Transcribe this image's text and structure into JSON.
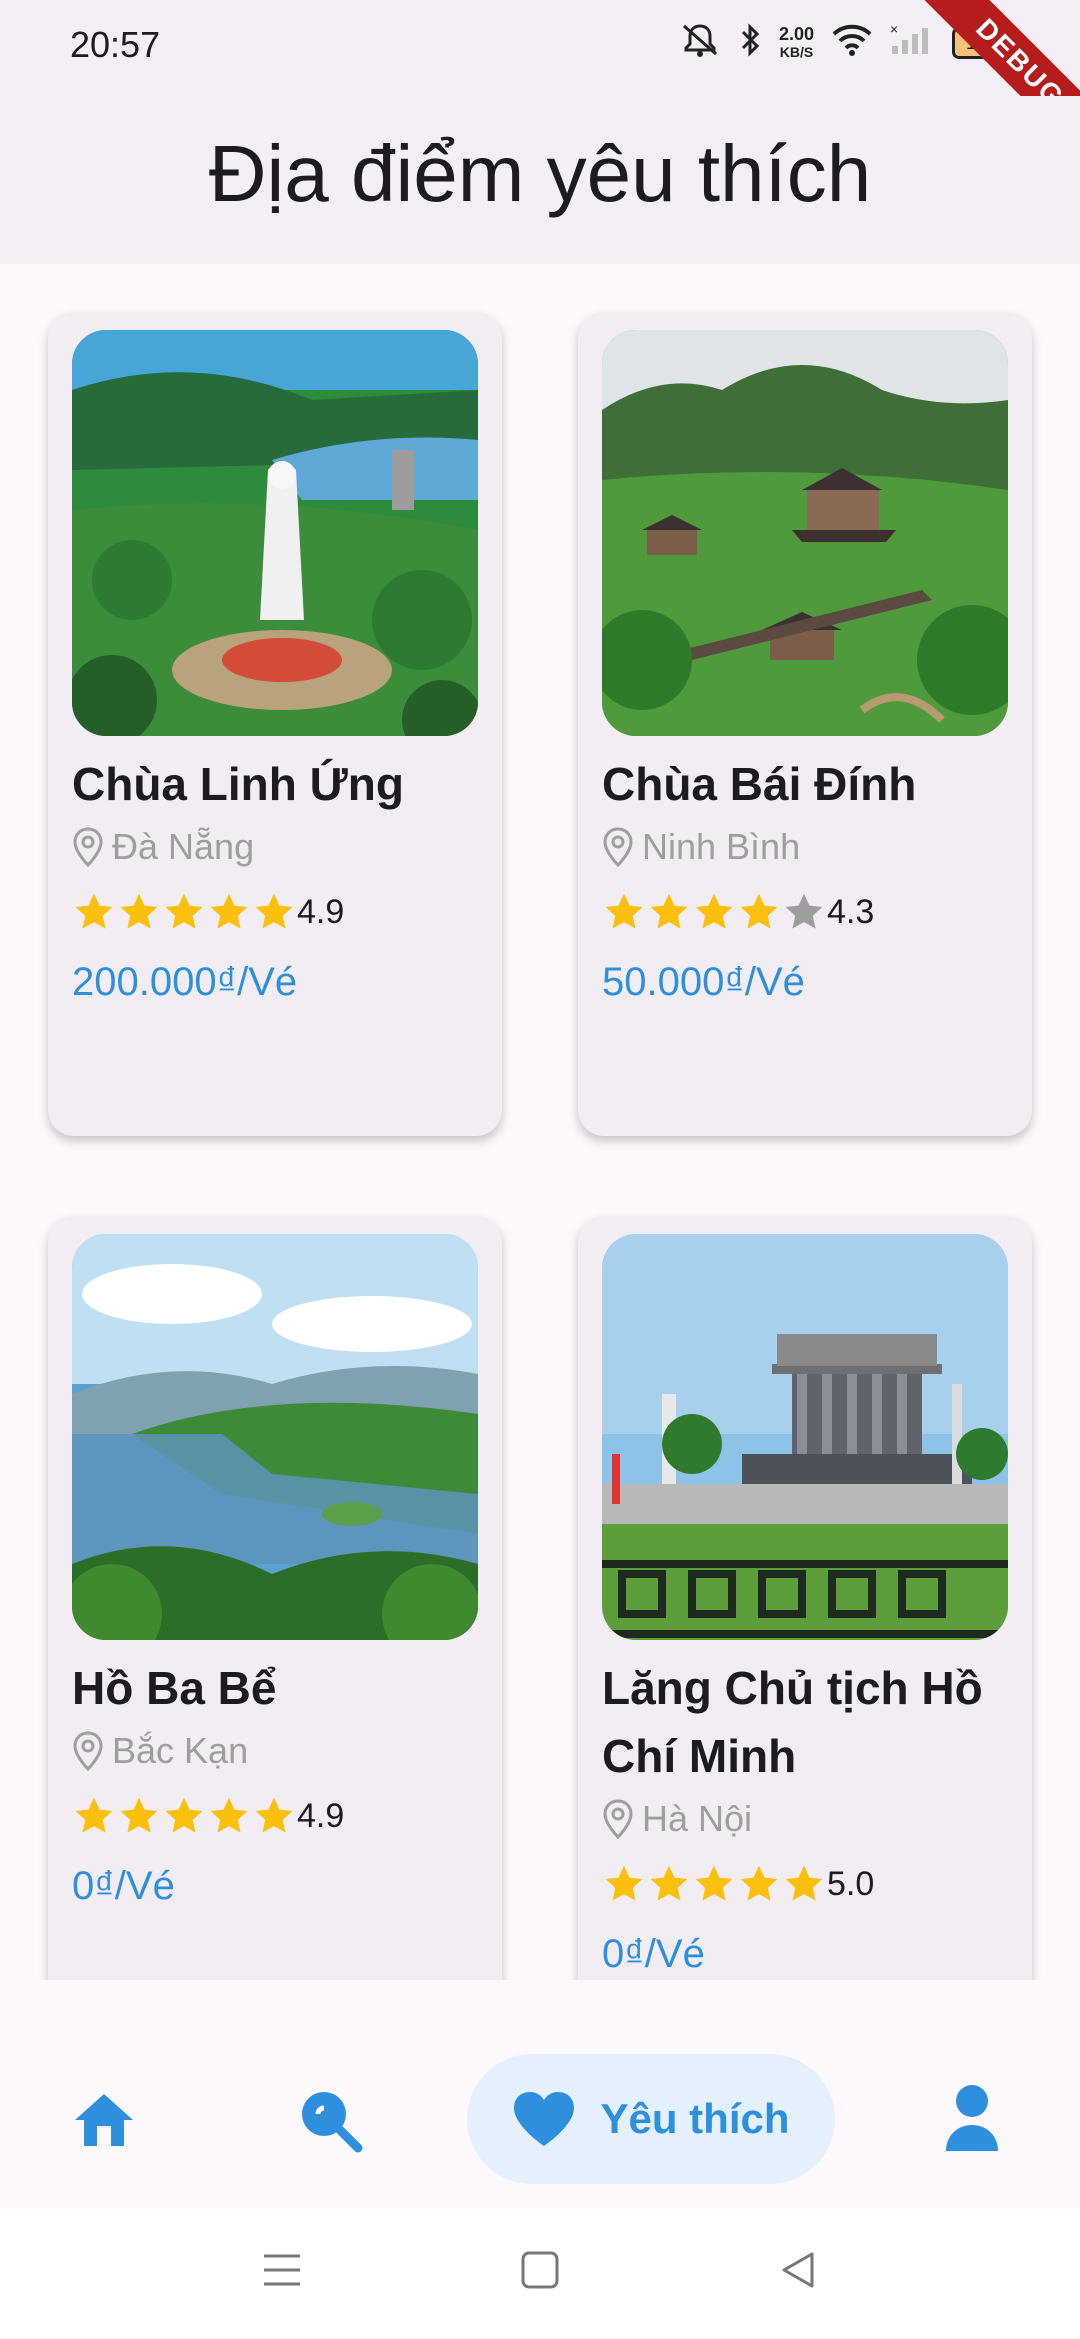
{
  "status_bar": {
    "time": "20:57",
    "net_speed_value": "2.00",
    "net_speed_unit": "KB/S",
    "battery": "100",
    "debug_banner": "DEBUG",
    "icons": [
      "mute-icon",
      "bluetooth-icon",
      "wifi-icon",
      "signal-icon",
      "battery-icon"
    ]
  },
  "app_bar": {
    "title": "Địa điểm yêu thích"
  },
  "places": [
    {
      "name": "Chùa Linh Ứng",
      "location": "Đà Nẵng",
      "rating": "4.9",
      "stars_filled": 5,
      "price": "200.000₫/Vé"
    },
    {
      "name": "Chùa Bái Đính",
      "location": "Ninh Bình",
      "rating": "4.3",
      "stars_filled": 4,
      "price": "50.000₫/Vé"
    },
    {
      "name": "Hồ Ba Bể",
      "location": "Bắc Kạn",
      "rating": "4.9",
      "stars_filled": 5,
      "price": "0₫/Vé"
    },
    {
      "name": "Lăng Chủ tịch Hồ Chí Minh",
      "location": "Hà Nội",
      "rating": "5.0",
      "stars_filled": 5,
      "price": "0₫/Vé"
    }
  ],
  "bottom_nav": {
    "items": [
      {
        "icon": "home-icon"
      },
      {
        "icon": "search-icon"
      },
      {
        "icon": "heart-icon",
        "label": "Yêu thích",
        "active": true
      },
      {
        "icon": "person-icon"
      }
    ]
  },
  "colors": {
    "accent": "#2f8fdf",
    "star": "#fbbf0e",
    "star_empty": "#9e9e9e",
    "card_bg": "#f2edf3",
    "active_nav_bg": "#e4f0fb"
  }
}
